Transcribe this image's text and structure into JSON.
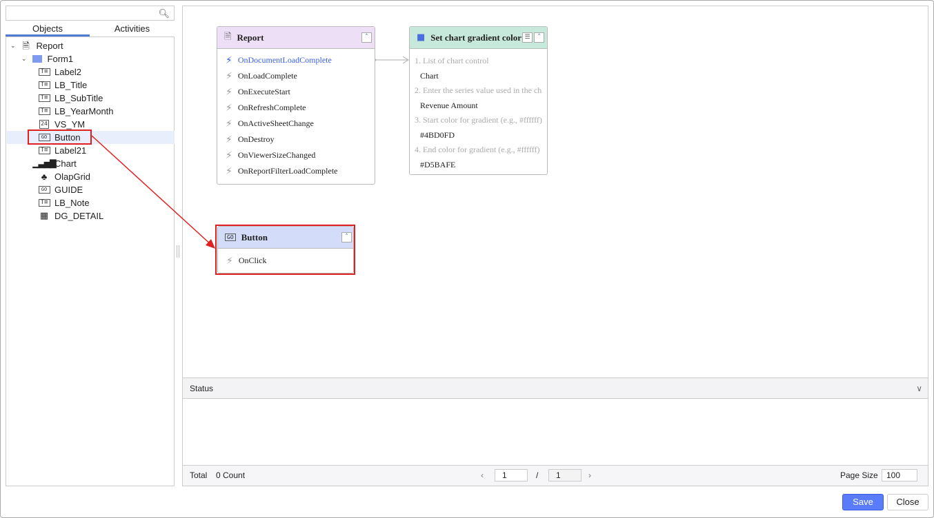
{
  "search": {
    "placeholder": ""
  },
  "tabs": [
    "Objects",
    "Activities"
  ],
  "tree": [
    {
      "label": "Report",
      "icon": "document-icon",
      "level": 0
    },
    {
      "label": "Form1",
      "icon": "folder-icon",
      "level": 1
    },
    {
      "label": "Label2",
      "icon": "label-icon",
      "level": 2
    },
    {
      "label": "LB_Title",
      "icon": "label-icon",
      "level": 2
    },
    {
      "label": "LB_SubTitle",
      "icon": "label-icon",
      "level": 2
    },
    {
      "label": "LB_YearMonth",
      "icon": "label-icon",
      "level": 2
    },
    {
      "label": "VS_YM",
      "icon": "calendar-icon",
      "level": 2
    },
    {
      "label": "Button",
      "icon": "button-icon",
      "level": 2
    },
    {
      "label": "Label21",
      "icon": "label-icon",
      "level": 2
    },
    {
      "label": "Chart",
      "icon": "chart-icon",
      "level": 2
    },
    {
      "label": "OlapGrid",
      "icon": "olap-icon",
      "level": 2
    },
    {
      "label": "GUIDE",
      "icon": "button-icon",
      "level": 2
    },
    {
      "label": "LB_Note",
      "icon": "label-icon",
      "level": 2
    },
    {
      "label": "DG_DETAIL",
      "icon": "grid-icon",
      "level": 2
    }
  ],
  "report_node": {
    "title": "Report",
    "events": [
      "OnDocumentLoadComplete",
      "OnLoadComplete",
      "OnExecuteStart",
      "OnRefreshComplete",
      "OnActiveSheetChange",
      "OnDestroy",
      "OnViewerSizeChanged",
      "OnReportFilterLoadComplete"
    ]
  },
  "action_node": {
    "title": "Set chart gradient color e",
    "params": [
      {
        "label": "1. List of chart control",
        "value": "Chart"
      },
      {
        "label": "2. Enter the series value used in the ch",
        "value": "Revenue Amount"
      },
      {
        "label": "3. Start color for gradient (e.g., #ffffff)",
        "value": "#4BD0FD"
      },
      {
        "label": "4. End color for gradient (e.g., #ffffff)",
        "value": "#D5BAFE"
      }
    ]
  },
  "button_node": {
    "title": "Button",
    "icon_text": "GO",
    "events": [
      "OnClick"
    ]
  },
  "status": {
    "title": "Status"
  },
  "footer": {
    "total": "Total",
    "count": "0 Count",
    "page": "1",
    "sep": "/",
    "pages": "1",
    "page_size_label": "Page Size",
    "page_size": "100"
  },
  "buttons": {
    "save": "Save",
    "close": "Close"
  },
  "colors": {
    "accent": "#5b7cfa",
    "highlight": "#e02020"
  }
}
